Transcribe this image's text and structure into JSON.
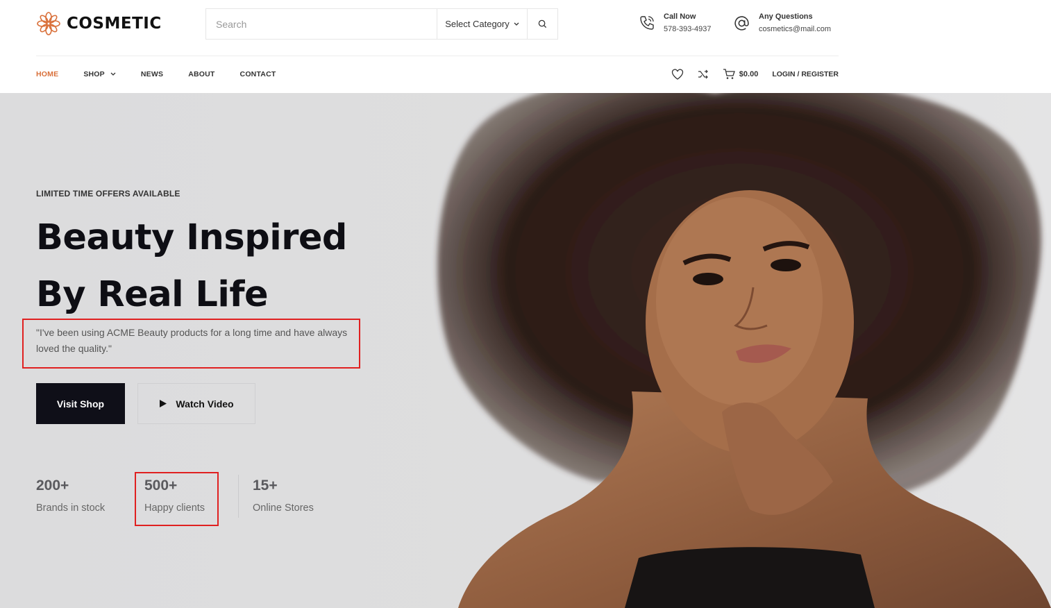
{
  "brand": {
    "name": "COSMETIC",
    "accent": "#d9703a",
    "icon": "flower-logo-icon"
  },
  "search": {
    "placeholder": "Search",
    "category_label": "Select Category",
    "icon": "search-icon"
  },
  "contact": {
    "call": {
      "title": "Call Now",
      "value": "578-393-4937",
      "icon": "phone-icon"
    },
    "mail": {
      "title": "Any Questions",
      "value": "cosmetics@mail.com",
      "icon": "at-sign-icon"
    }
  },
  "nav": {
    "items": [
      {
        "label": "HOME",
        "active": true
      },
      {
        "label": "SHOP",
        "has_dropdown": true
      },
      {
        "label": "NEWS"
      },
      {
        "label": "ABOUT"
      },
      {
        "label": "CONTACT"
      }
    ],
    "cart_total": "$0.00",
    "login_label": "LOGIN / REGISTER"
  },
  "hero": {
    "eyebrow": "LIMITED TIME OFFERS AVAILABLE",
    "headline_line1": "Beauty Inspired",
    "headline_line2": "By Real Life",
    "quote": "\"I've been using ACME Beauty products for a long time and have always loved the quality.\"",
    "primary_button": "Visit Shop",
    "secondary_button": "Watch Video"
  },
  "stats": [
    {
      "value": "200+",
      "label": "Brands in stock"
    },
    {
      "value": "500+",
      "label": "Happy clients"
    },
    {
      "value": "15+",
      "label": "Online Stores"
    }
  ],
  "colors": {
    "highlight_outline": "#e02020",
    "button_dark": "#0f0f18",
    "hero_background": "#dcdcdd"
  }
}
